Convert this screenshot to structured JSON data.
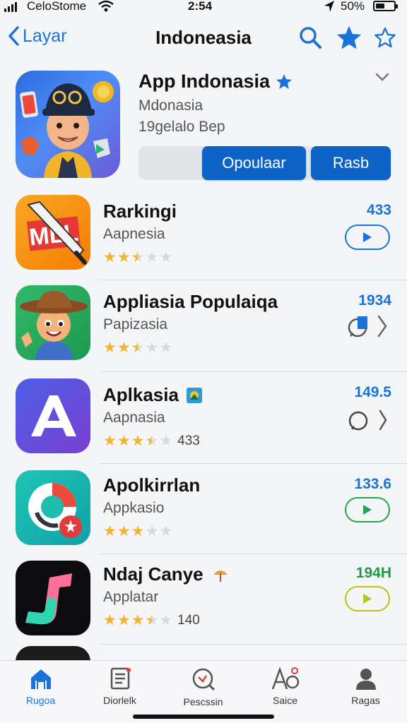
{
  "status_bar": {
    "carrier": "CeloStome",
    "time": "2:54",
    "battery_text": "50%",
    "battery_level": 0.5
  },
  "nav": {
    "back_label": "Layar",
    "title": "Indoneasia"
  },
  "featured": {
    "name": "App Indonasia",
    "subtitle": "Mdonasia",
    "meta": "19gelalo Bep",
    "segments": [
      "Opoulaar",
      "Rasb"
    ]
  },
  "apps": [
    {
      "name": "Rarkingi",
      "subtitle": "Aapnesia",
      "rating": 2.5,
      "rating_count": "",
      "number": "433",
      "number_color": "#1a73d9",
      "action": "play-outline",
      "action_color": "#1a73d9",
      "icon": "mll-icon"
    },
    {
      "name": "Appliasia Populaiqa",
      "subtitle": "Papizasia",
      "rating": 2.5,
      "rating_count": "",
      "number": "1934",
      "number_color": "#1a73d9",
      "action": "share-chevron",
      "action_color": "#555555",
      "icon": "cowboy-icon"
    },
    {
      "name": "Aplkasia",
      "subtitle": "Aapnasia",
      "rating": 3.5,
      "rating_count": "433",
      "number": "149.5",
      "number_color": "#1a73d9",
      "action": "comment-chevron",
      "action_color": "#444444",
      "icon": "letter-a-icon"
    },
    {
      "name": "Apolkirrlan",
      "subtitle": "Appkasio",
      "rating": 3,
      "rating_count": "",
      "number": "133.6",
      "number_color": "#1a73d9",
      "action": "play-outline",
      "action_color": "#21a84a",
      "icon": "ring-icon"
    },
    {
      "name": "Ndaj Canye",
      "subtitle": "Applatar",
      "rating": 3.5,
      "rating_count": "140",
      "number": "194H",
      "number_color": "#1f9a4a",
      "action": "play-outline",
      "action_color": "#b9c21e",
      "icon": "j-logo-icon"
    }
  ],
  "tabs": [
    {
      "label": "Rugoa",
      "icon": "home-icon",
      "active": true
    },
    {
      "label": "Diorlelk",
      "icon": "document-icon",
      "active": false
    },
    {
      "label": "Pescssin",
      "icon": "search-tab-icon",
      "active": false
    },
    {
      "label": "Saice",
      "icon": "apps-icon",
      "active": false
    },
    {
      "label": "Ragas",
      "icon": "person-icon",
      "active": false
    }
  ],
  "colors": {
    "accent": "#1a73d9",
    "segment_button": "#0d63c6",
    "star": "#f2b233",
    "background": "#f4f5f7"
  }
}
